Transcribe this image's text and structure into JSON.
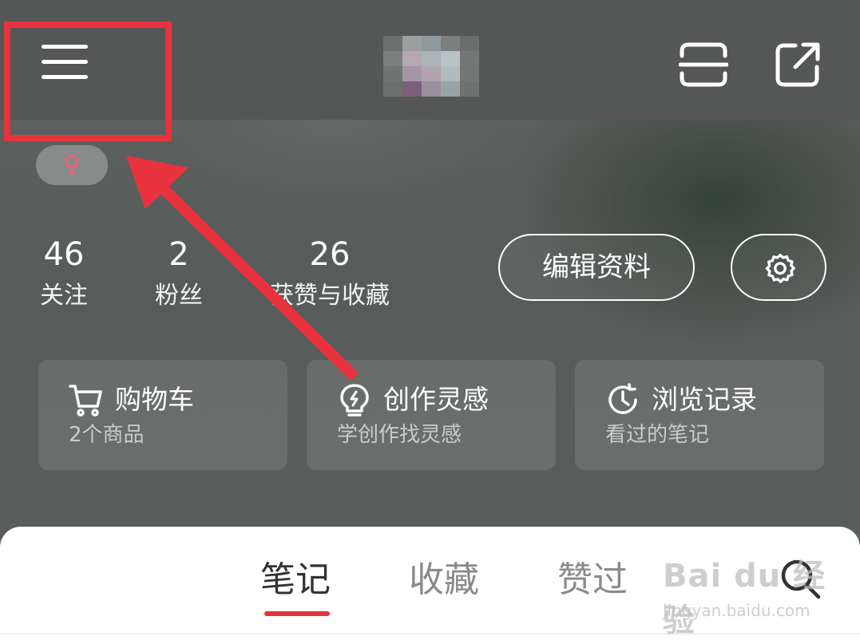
{
  "profile": {
    "gender_symbol": "♀"
  },
  "stats": [
    {
      "value": "46",
      "label": "关注"
    },
    {
      "value": "2",
      "label": "粉丝"
    },
    {
      "value": "26",
      "label": "获赞与收藏"
    }
  ],
  "actions": {
    "edit_profile": "编辑资料"
  },
  "cards": [
    {
      "title": "购物车",
      "subtitle": "2个商品",
      "icon": "cart-icon"
    },
    {
      "title": "创作灵感",
      "subtitle": "学创作找灵感",
      "icon": "lightbulb-icon"
    },
    {
      "title": "浏览记录",
      "subtitle": "看过的笔记",
      "icon": "clock-icon"
    }
  ],
  "tabs": [
    {
      "label": "笔记",
      "active": true
    },
    {
      "label": "收藏",
      "active": false
    },
    {
      "label": "赞过",
      "active": false
    }
  ],
  "watermark": {
    "main": "Bai du 经验",
    "url": "jingyan.baidu.com"
  },
  "colors": {
    "accent_red": "#e2343f",
    "annotation_red": "#e8323e",
    "gender_pink": "#f06273"
  },
  "icons": [
    "menu-icon",
    "scan-icon",
    "share-icon",
    "gear-icon",
    "search-icon"
  ]
}
